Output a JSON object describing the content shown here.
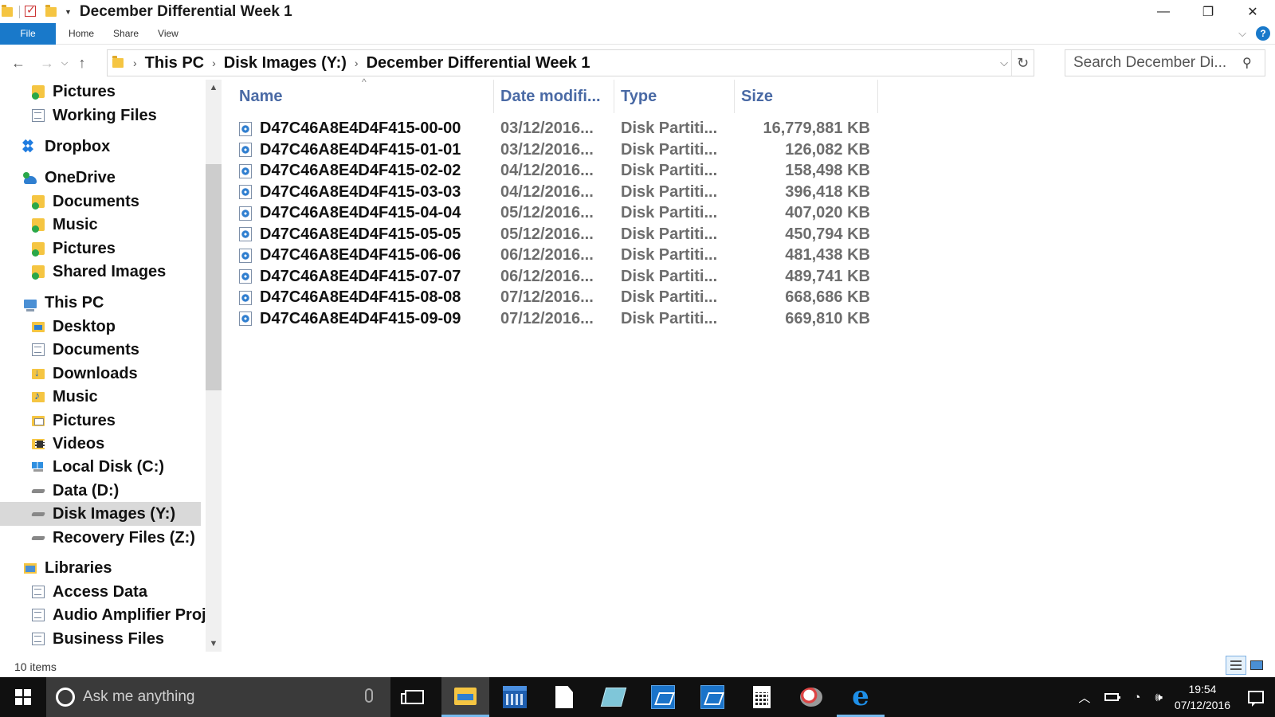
{
  "window": {
    "title": "December Differential Week 1",
    "controls": {
      "minimize": "—",
      "maximize": "❐",
      "close": "✕"
    }
  },
  "ribbon": {
    "tabs": [
      "File",
      "Home",
      "Share",
      "View"
    ]
  },
  "address_bar": {
    "crumbs": [
      "This PC",
      "Disk Images (Y:)",
      "December Differential Week 1"
    ]
  },
  "search": {
    "placeholder": "Search December Di..."
  },
  "sidebar": {
    "items": [
      {
        "label": "Pictures",
        "icon": "synced-folder-icon",
        "indent": 1,
        "selected": false
      },
      {
        "label": "Working Files",
        "icon": "document-icon",
        "indent": 1,
        "selected": false
      },
      {
        "label": "Dropbox",
        "icon": "dropbox-icon",
        "indent": 0,
        "selected": false
      },
      {
        "label": "OneDrive",
        "icon": "onedrive-icon",
        "indent": 0,
        "selected": false
      },
      {
        "label": "Documents",
        "icon": "synced-folder-icon",
        "indent": 1,
        "selected": false
      },
      {
        "label": "Music",
        "icon": "synced-folder-icon",
        "indent": 1,
        "selected": false
      },
      {
        "label": "Pictures",
        "icon": "synced-folder-icon",
        "indent": 1,
        "selected": false
      },
      {
        "label": "Shared Images",
        "icon": "synced-folder-icon",
        "indent": 1,
        "selected": false
      },
      {
        "label": "This PC",
        "icon": "computer-icon",
        "indent": 0,
        "selected": false
      },
      {
        "label": "Desktop",
        "icon": "desktop-folder-icon",
        "indent": 1,
        "selected": false
      },
      {
        "label": "Documents",
        "icon": "documents-folder-icon",
        "indent": 1,
        "selected": false
      },
      {
        "label": "Downloads",
        "icon": "downloads-folder-icon",
        "indent": 1,
        "selected": false
      },
      {
        "label": "Music",
        "icon": "music-folder-icon",
        "indent": 1,
        "selected": false
      },
      {
        "label": "Pictures",
        "icon": "pictures-folder-icon",
        "indent": 1,
        "selected": false
      },
      {
        "label": "Videos",
        "icon": "videos-folder-icon",
        "indent": 1,
        "selected": false
      },
      {
        "label": "Local Disk (C:)",
        "icon": "windows-drive-icon",
        "indent": 1,
        "selected": false
      },
      {
        "label": "Data (D:)",
        "icon": "drive-icon",
        "indent": 1,
        "selected": false
      },
      {
        "label": "Disk Images (Y:)",
        "icon": "drive-icon",
        "indent": 1,
        "selected": true
      },
      {
        "label": "Recovery Files (Z:)",
        "icon": "drive-icon",
        "indent": 1,
        "selected": false
      },
      {
        "label": "Libraries",
        "icon": "libraries-icon",
        "indent": 0,
        "selected": false
      },
      {
        "label": "Access Data",
        "icon": "document-icon",
        "indent": 1,
        "selected": false
      },
      {
        "label": "Audio Amplifier Proj",
        "icon": "document-icon",
        "indent": 1,
        "selected": false
      },
      {
        "label": "Business Files",
        "icon": "document-icon",
        "indent": 1,
        "selected": false
      }
    ]
  },
  "file_list": {
    "columns": {
      "name": "Name",
      "date": "Date modifi...",
      "type": "Type",
      "size": "Size"
    },
    "rows": [
      {
        "name": "D47C46A8E4D4F415-00-00",
        "date": "03/12/2016...",
        "type": "Disk Partiti...",
        "size": "16,779,881 KB"
      },
      {
        "name": "D47C46A8E4D4F415-01-01",
        "date": "03/12/2016...",
        "type": "Disk Partiti...",
        "size": "126,082 KB"
      },
      {
        "name": "D47C46A8E4D4F415-02-02",
        "date": "04/12/2016...",
        "type": "Disk Partiti...",
        "size": "158,498 KB"
      },
      {
        "name": "D47C46A8E4D4F415-03-03",
        "date": "04/12/2016...",
        "type": "Disk Partiti...",
        "size": "396,418 KB"
      },
      {
        "name": "D47C46A8E4D4F415-04-04",
        "date": "05/12/2016...",
        "type": "Disk Partiti...",
        "size": "407,020 KB"
      },
      {
        "name": "D47C46A8E4D4F415-05-05",
        "date": "05/12/2016...",
        "type": "Disk Partiti...",
        "size": "450,794 KB"
      },
      {
        "name": "D47C46A8E4D4F415-06-06",
        "date": "06/12/2016...",
        "type": "Disk Partiti...",
        "size": "481,438 KB"
      },
      {
        "name": "D47C46A8E4D4F415-07-07",
        "date": "06/12/2016...",
        "type": "Disk Partiti...",
        "size": "489,741 KB"
      },
      {
        "name": "D47C46A8E4D4F415-08-08",
        "date": "07/12/2016...",
        "type": "Disk Partiti...",
        "size": "668,686 KB"
      },
      {
        "name": "D47C46A8E4D4F415-09-09",
        "date": "07/12/2016...",
        "type": "Disk Partiti...",
        "size": "669,810 KB"
      }
    ]
  },
  "status_bar": {
    "item_count": "10 items"
  },
  "taskbar": {
    "search_placeholder": "Ask me anything",
    "clock_time": "19:54",
    "clock_date": "07/12/2016"
  },
  "colors": {
    "accent": "#1979ca",
    "column_header": "#4a6aa5",
    "selected_bg": "#d9d9d9",
    "taskbar_bg": "#101010"
  }
}
